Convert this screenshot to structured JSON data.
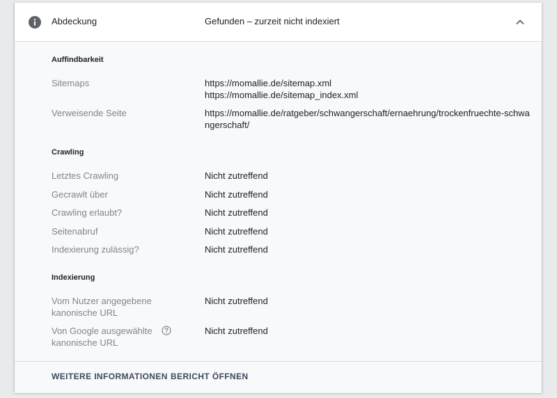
{
  "header": {
    "icon": "info-icon",
    "label": "Abdeckung",
    "value": "Gefunden – zurzeit nicht indexiert",
    "toggle_icon": "chevron-up-icon"
  },
  "sections": {
    "auffindbarkeit": {
      "title": "Auffindbarkeit",
      "sitemaps_label": "Sitemaps",
      "sitemap_1": "https://momallie.de/sitemap.xml",
      "sitemap_2": "https://momallie.de/sitemap_index.xml",
      "referring_label": "Verweisende Seite",
      "referring_line_1": "https://momallie.de/ratgeber/schwangerschaft/ernaehrung/trockenfruechte-schwa",
      "referring_line_2": "ngerschaft/"
    },
    "crawling": {
      "title": "Crawling",
      "rows": [
        {
          "label": "Letztes Crawling",
          "value": "Nicht zutreffend"
        },
        {
          "label": "Gecrawlt über",
          "value": "Nicht zutreffend"
        },
        {
          "label": "Crawling erlaubt?",
          "value": "Nicht zutreffend"
        },
        {
          "label": "Seitenabruf",
          "value": "Nicht zutreffend"
        },
        {
          "label": "Indexierung zulässig?",
          "value": "Nicht zutreffend"
        }
      ]
    },
    "indexierung": {
      "title": "Indexierung",
      "user_canonical_label_1": "Vom Nutzer angegebene",
      "user_canonical_label_2": "kanonische URL",
      "user_canonical_value": "Nicht zutreffend",
      "google_canonical_label_1": "Von Google ausgewählte",
      "google_canonical_label_2": "kanonische URL",
      "google_canonical_value": "Nicht zutreffend",
      "help_icon": "help-circle-icon"
    }
  },
  "footer": {
    "more_info": "WEITERE INFORMATIONEN",
    "open_report": "BERICHT ÖFFNEN"
  },
  "colors": {
    "label_gray": "#80868b",
    "text": "#202124",
    "icon": "#5f6368",
    "footer_button": "#3c4a5c"
  }
}
